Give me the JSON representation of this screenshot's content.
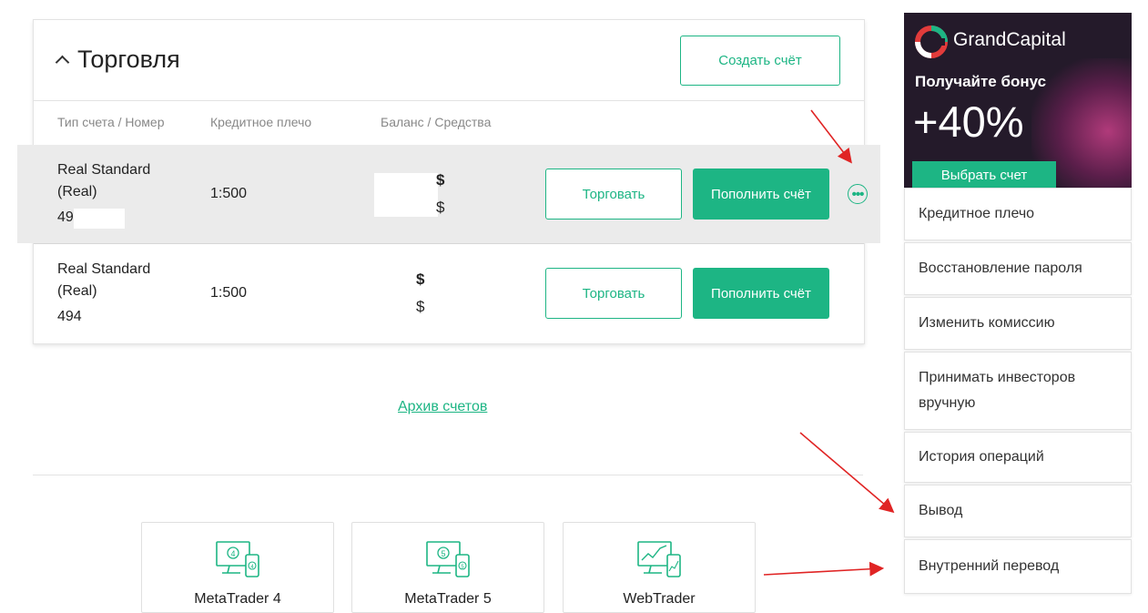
{
  "section": {
    "title": "Торговля",
    "create_button": "Создать счёт",
    "columns": [
      "Тип счета / Номер",
      "Кредитное плечо",
      "Баланс / Средства"
    ]
  },
  "accounts": [
    {
      "type": "Real Standard (Real)",
      "number": "49",
      "leverage": "1:500",
      "balance_currency": "$",
      "equity_currency": "$",
      "trade_button": "Торговать",
      "deposit_button": "Пополнить счёт"
    },
    {
      "type": "Real Standard (Real)",
      "number": "494",
      "leverage": "1:500",
      "balance_currency": "$",
      "equity_currency": "$",
      "trade_button": "Торговать",
      "deposit_button": "Пополнить счёт"
    }
  ],
  "archive_link": "Архив счетов",
  "platforms": [
    {
      "name": "MetaTrader 4",
      "icon": "monitor-4-icon"
    },
    {
      "name": "MetaTrader 5",
      "icon": "monitor-5-icon"
    },
    {
      "name": "WebTrader",
      "icon": "chart-monitor-icon"
    }
  ],
  "ad": {
    "brand": "GrandCapital",
    "headline": "Получайте бонус",
    "percent": "+40%",
    "button": "Выбрать счет"
  },
  "dropdown_menu": [
    "Кредитное плечо",
    "Восстановление пароля",
    "Изменить комиссию",
    "Принимать инвесторов вручную",
    "История операций",
    "Вывод",
    "Внутренний перевод"
  ],
  "colors": {
    "accent": "#1db584",
    "arrow": "#e02424"
  }
}
